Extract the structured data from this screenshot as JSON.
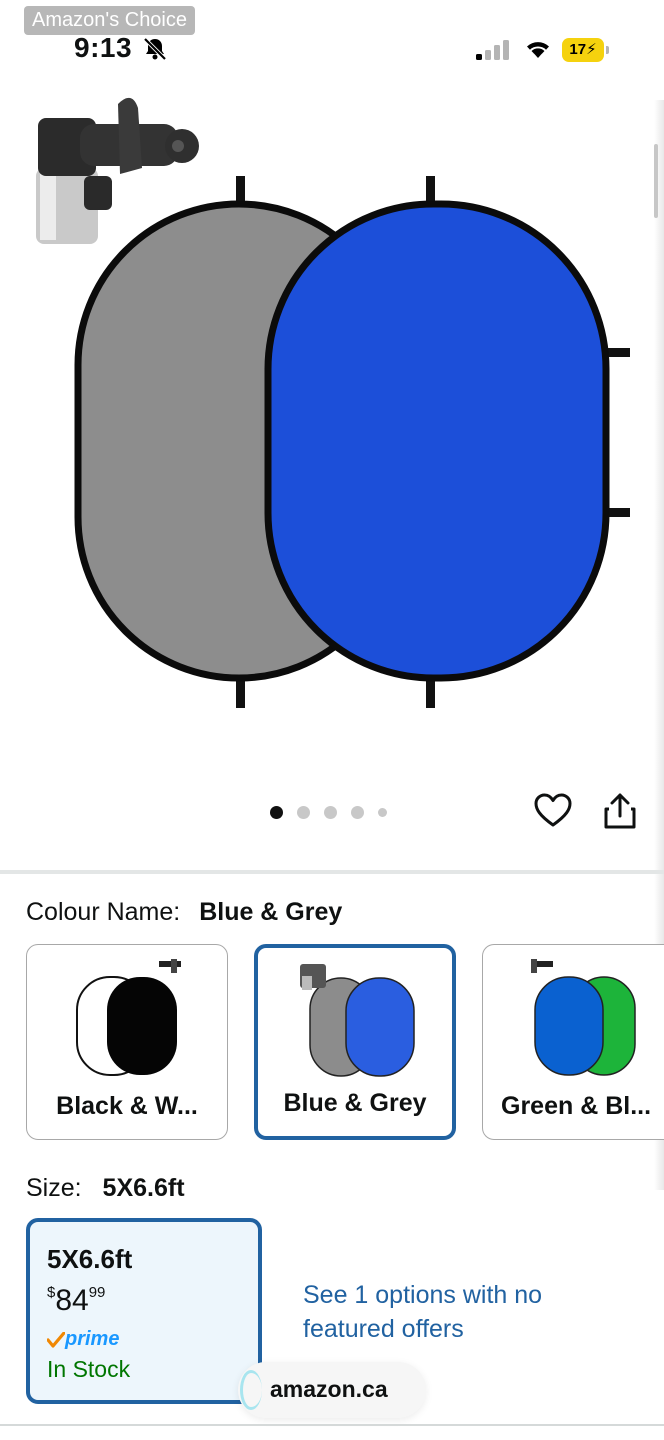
{
  "status_bar": {
    "badge": "Amazon's Choice",
    "time": "9:13",
    "battery": "17"
  },
  "gallery": {
    "image_count": 5,
    "active_index": 0,
    "colors": {
      "grey_panel": "#8c8c8c",
      "blue_panel": "#1c4fd9",
      "green_panel": "#1db43a"
    }
  },
  "colour": {
    "label": "Colour Name:",
    "selected": "Blue & Grey",
    "options": [
      {
        "name": "Black & W..."
      },
      {
        "name": "Blue & Grey"
      },
      {
        "name": "Green & Bl..."
      }
    ]
  },
  "size": {
    "label": "Size:",
    "selected": "5X6.6ft",
    "card": {
      "name": "5X6.6ft",
      "currency": "$",
      "price_whole": "84",
      "price_fraction": "99",
      "prime": "prime",
      "availability": "In Stock"
    },
    "more_offers": "See 1 options with no featured offers"
  },
  "browser": {
    "url": "amazon.ca"
  },
  "accent_color": "#2162a1"
}
